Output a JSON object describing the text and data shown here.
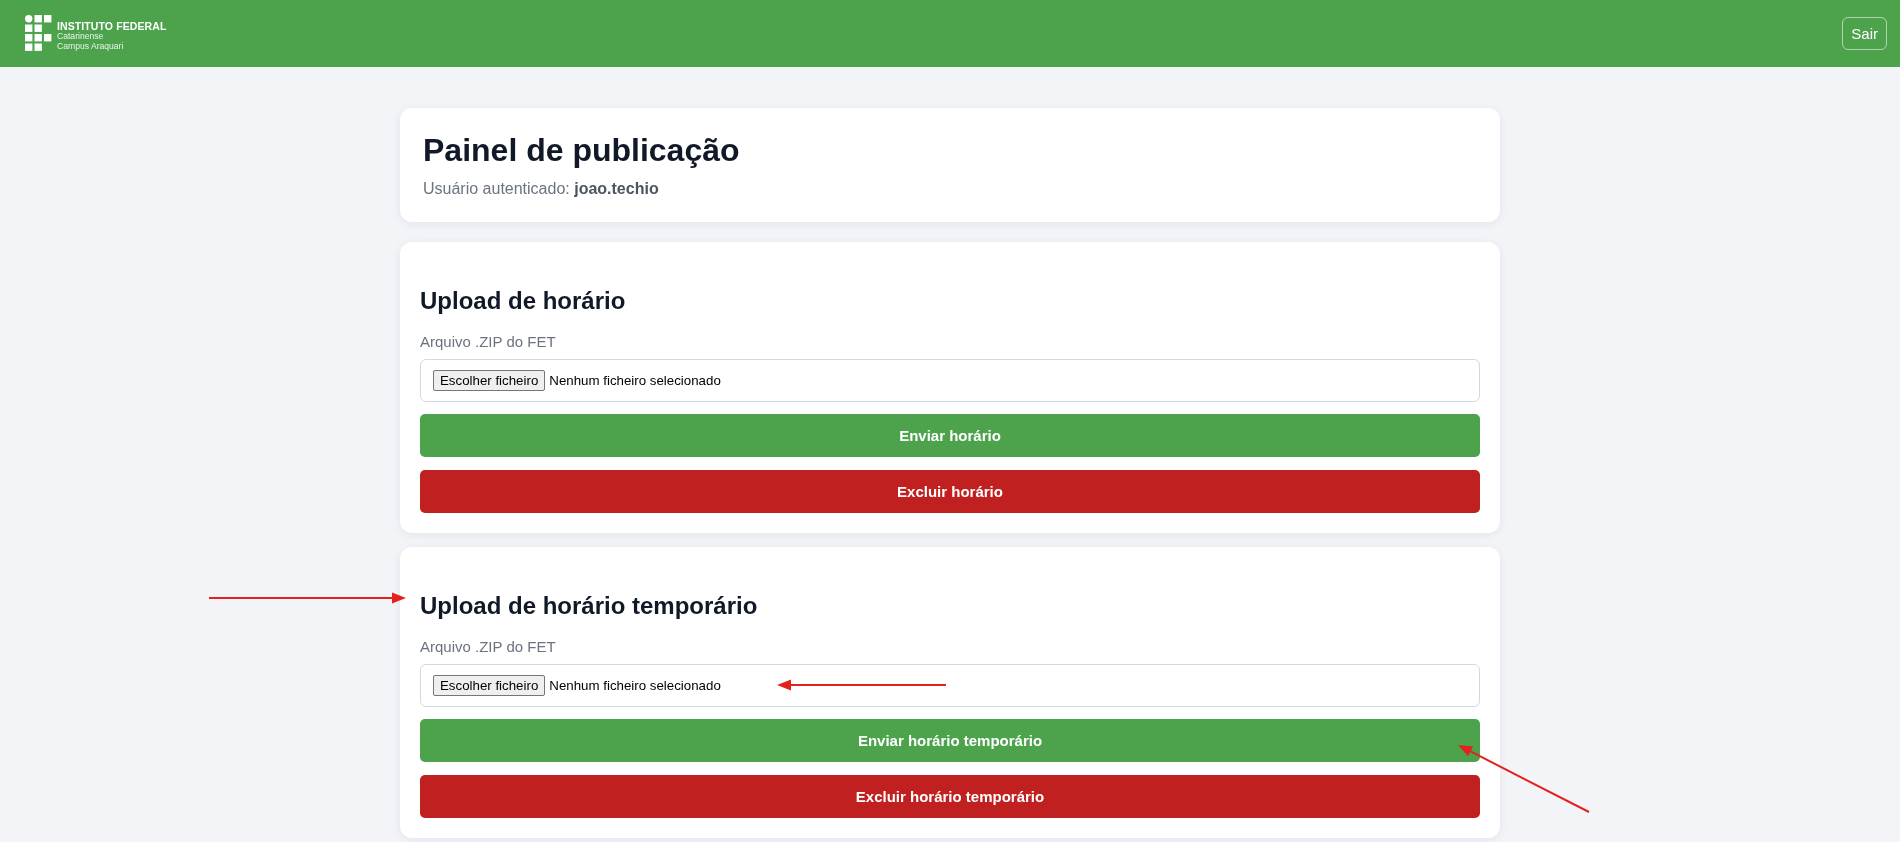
{
  "header": {
    "logo": {
      "title": "INSTITUTO FEDERAL",
      "lines": [
        "Catarinense",
        "Campus Araquari"
      ]
    },
    "logout_button": "Sair"
  },
  "panel": {
    "title": "Painel de publicação",
    "user_line": "Usuário autenticado: **joao.techio**"
  },
  "sections": [
    {
      "title": "Upload de horário",
      "file_field": {
        "label": "Arquivo .ZIP do FET",
        "button": "Escolher ficheiro",
        "status": "Nenhum ficheiro selecionado"
      },
      "actions": [
        {
          "kind": "submit",
          "label": "Enviar horário"
        },
        {
          "kind": "delete",
          "label": "Excluir horário"
        }
      ]
    },
    {
      "title": "Upload de horário temporário",
      "file_field": {
        "label": "Arquivo .ZIP do FET",
        "button": "Escolher ficheiro",
        "status": "Nenhum ficheiro selecionado"
      },
      "actions": [
        {
          "kind": "submit",
          "label": "Enviar horário temporário"
        },
        {
          "kind": "delete",
          "label": "Excluir horário temporário"
        }
      ]
    }
  ]
}
